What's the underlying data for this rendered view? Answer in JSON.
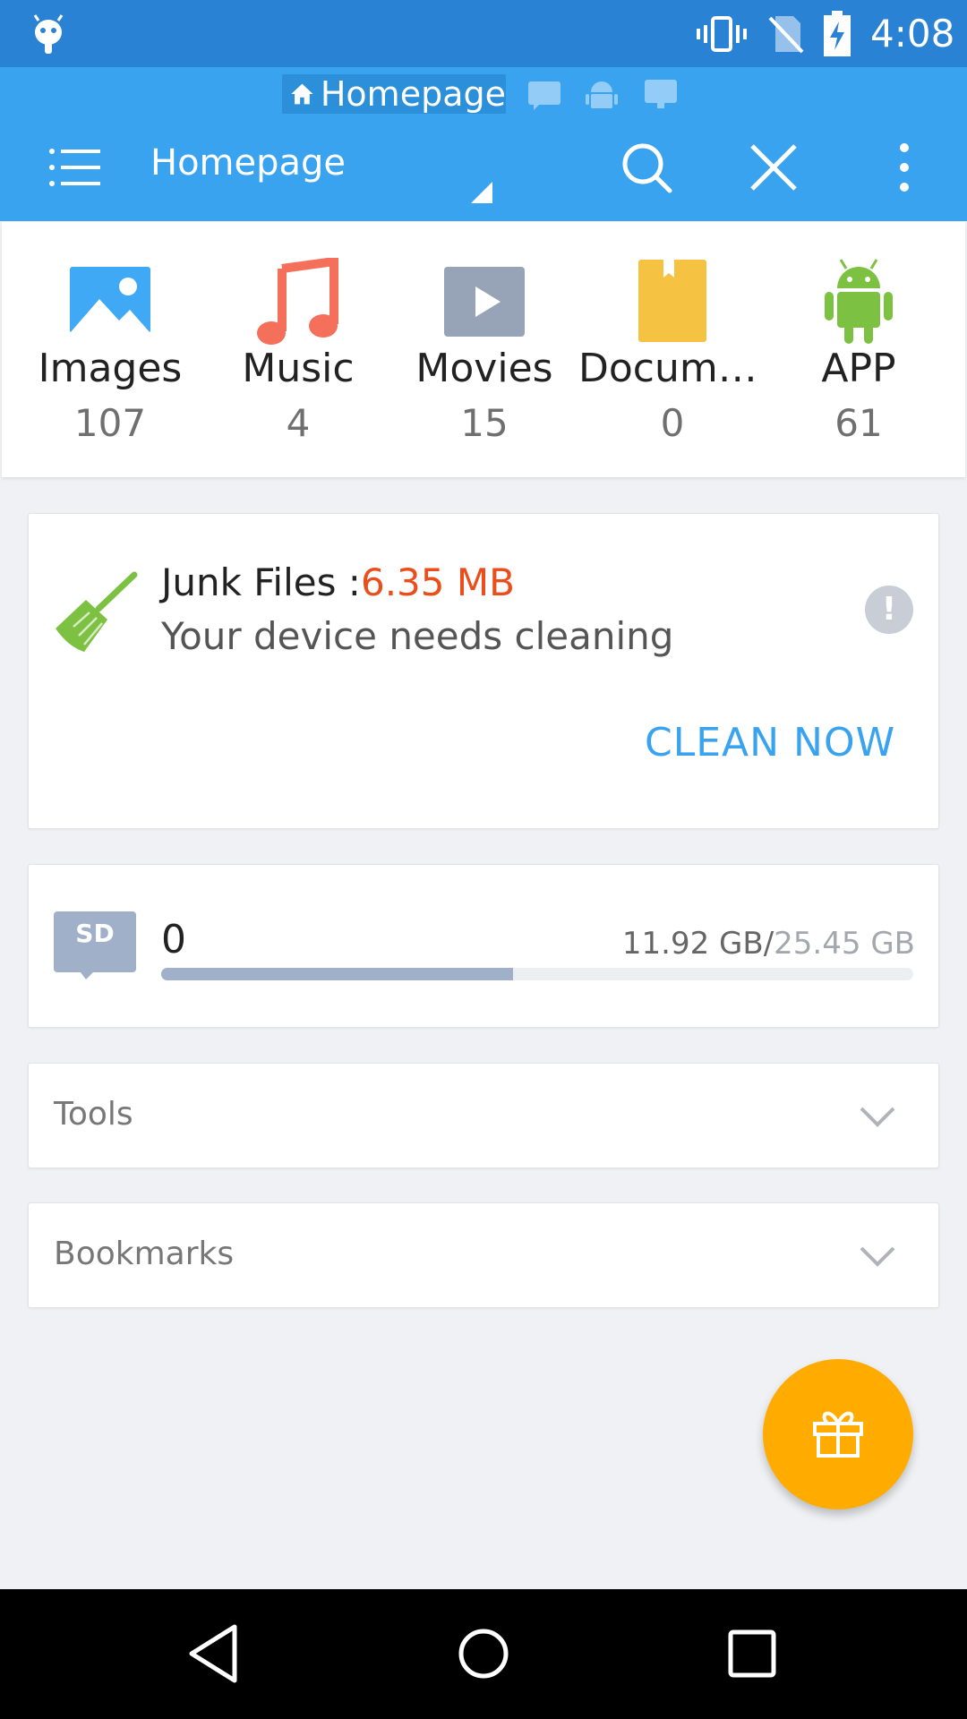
{
  "status_bar": {
    "time": "4:08",
    "icons": [
      "android-debug-icon",
      "vibrate-icon",
      "no-sim-icon",
      "battery-charging-icon"
    ]
  },
  "app_bar": {
    "active_tab": "Homepage",
    "tabs": [
      "Homepage",
      "sd-card-tab-icon",
      "android-tab-icon",
      "network-tab-icon"
    ],
    "title": "Homepage",
    "accent": "#3aa3ef"
  },
  "categories": [
    {
      "label": "Images",
      "count": "107",
      "icon": "image-icon",
      "color": "#3fa9f5"
    },
    {
      "label": "Music",
      "count": "4",
      "icon": "music-note-icon",
      "color": "#f4705a"
    },
    {
      "label": "Movies",
      "count": "15",
      "icon": "movie-play-icon",
      "color": "#97a4b8"
    },
    {
      "label": "Docume...",
      "count": "0",
      "icon": "document-icon",
      "color": "#f5c241"
    },
    {
      "label": "APP",
      "count": "61",
      "icon": "android-app-icon",
      "color": "#7cc142"
    }
  ],
  "junk_card": {
    "prefix": "Junk Files :",
    "size": "6.35 MB",
    "message": "Your device needs cleaning",
    "action": "CLEAN NOW",
    "size_color": "#ea4e1c"
  },
  "storage_card": {
    "name": "0",
    "used": "11.92 GB",
    "separator": "/",
    "total": "25.45 GB",
    "used_fraction": 0.468
  },
  "sections": {
    "tools": "Tools",
    "bookmarks": "Bookmarks"
  },
  "fab": {
    "icon": "gift-icon",
    "color": "#ffab00"
  },
  "nav_bar": {
    "icons": [
      "back-icon",
      "home-icon",
      "recents-icon"
    ]
  }
}
